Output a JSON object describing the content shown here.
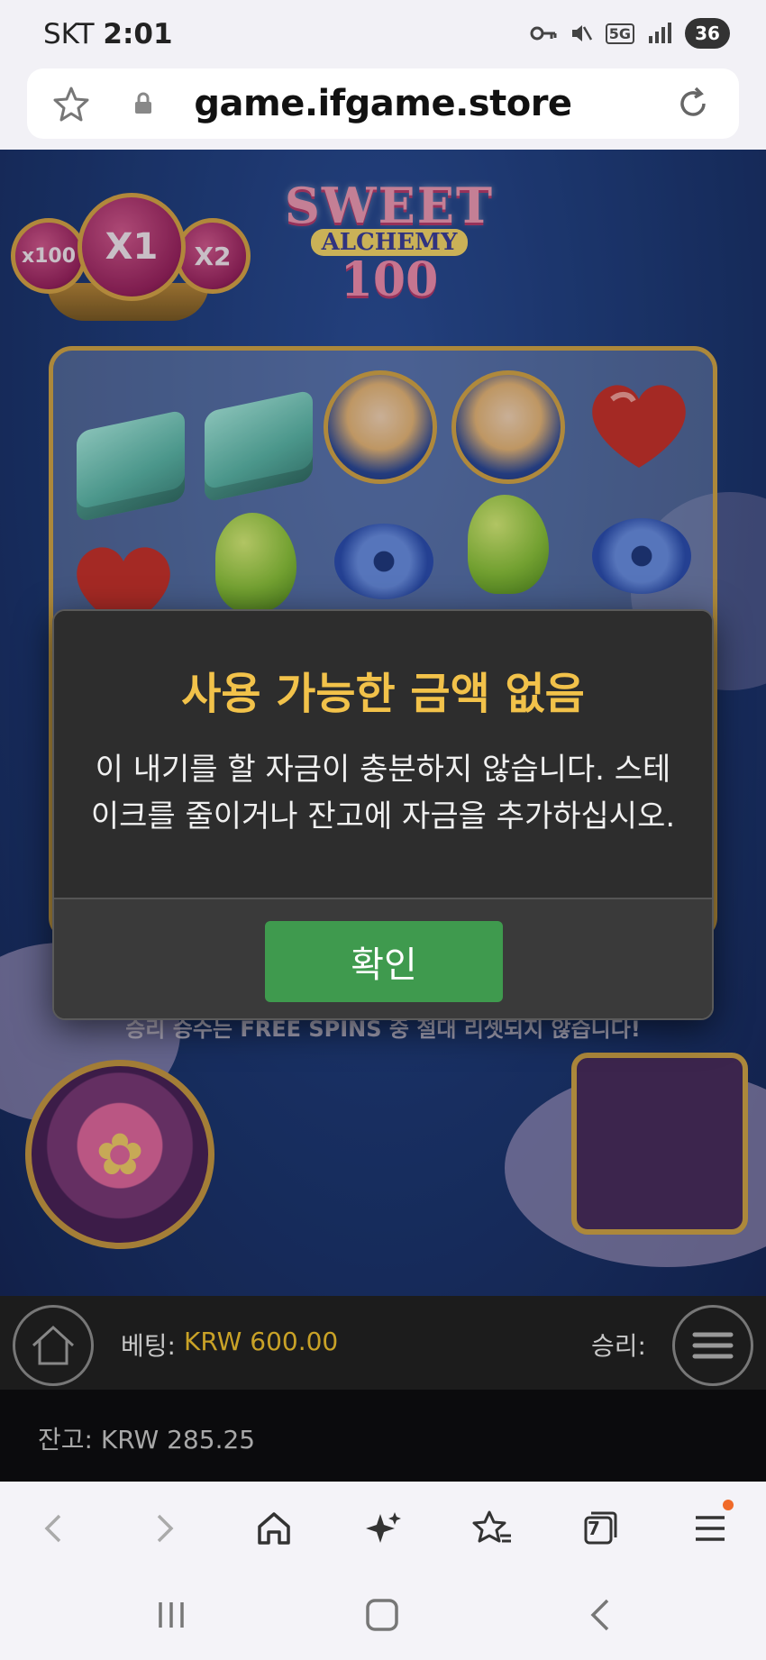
{
  "status_bar": {
    "carrier": "SKT",
    "time": "2:01",
    "network": "5G",
    "battery": "36"
  },
  "browser": {
    "url": "game.ifgame.store"
  },
  "game": {
    "multipliers": [
      "x100",
      "X1",
      "X2"
    ],
    "logo": {
      "line1": "SWEET",
      "line2": "ALCHEMY",
      "line3": "100"
    },
    "info_text": "승리 승수는 FREE SPINS 중 절대 리셋되지 않습니다!",
    "hud": {
      "bet_label": "베팅:",
      "bet_value": "KRW 600.00",
      "win_label": "승리:",
      "balance_label": "잔고: KRW 285.25"
    }
  },
  "modal": {
    "title": "사용 가능한 금액 없음",
    "message_line1": "이 내기를 할 자금이 충분하지 않습니다. 스테",
    "message_line2": "이크를 줄이거나 잔고에 자금을 추가하십시오.",
    "ok_label": "확인"
  },
  "toolbar": {
    "tabs_count": "7"
  },
  "colors": {
    "modal_title": "#f2c24a",
    "ok_button": "#3f9a4e",
    "bet_value": "#c9a227"
  }
}
